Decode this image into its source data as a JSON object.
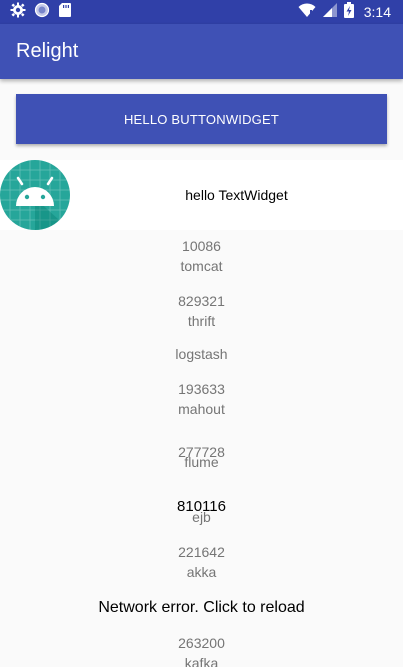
{
  "status_bar": {
    "time": "3:14",
    "icons": [
      "gear-icon",
      "sync-icon",
      "sd-card-icon",
      "wifi-icon",
      "signal-icon",
      "battery-icon"
    ],
    "color": "#3040a8"
  },
  "app_bar": {
    "title": "Relight",
    "color": "#3f51b5"
  },
  "button_widget": {
    "label": "HELLO BUTTONWIDGET"
  },
  "text_widget": {
    "label": "hello TextWidget",
    "icon": "android-icon"
  },
  "list": {
    "items": [
      {
        "number": "10086",
        "name": "tomcat"
      },
      {
        "number": "829321",
        "name": "thrift"
      },
      {
        "number": "",
        "name": "logstash"
      },
      {
        "number": "193633",
        "name": "mahout"
      },
      {
        "number": "277728",
        "name": "flume"
      },
      {
        "number": "810116",
        "name": "ejb"
      },
      {
        "number": "221642",
        "name": "akka"
      },
      {
        "number": "263200",
        "name": "kafka"
      }
    ]
  },
  "network_error": {
    "message": "Network error. Click to reload"
  }
}
